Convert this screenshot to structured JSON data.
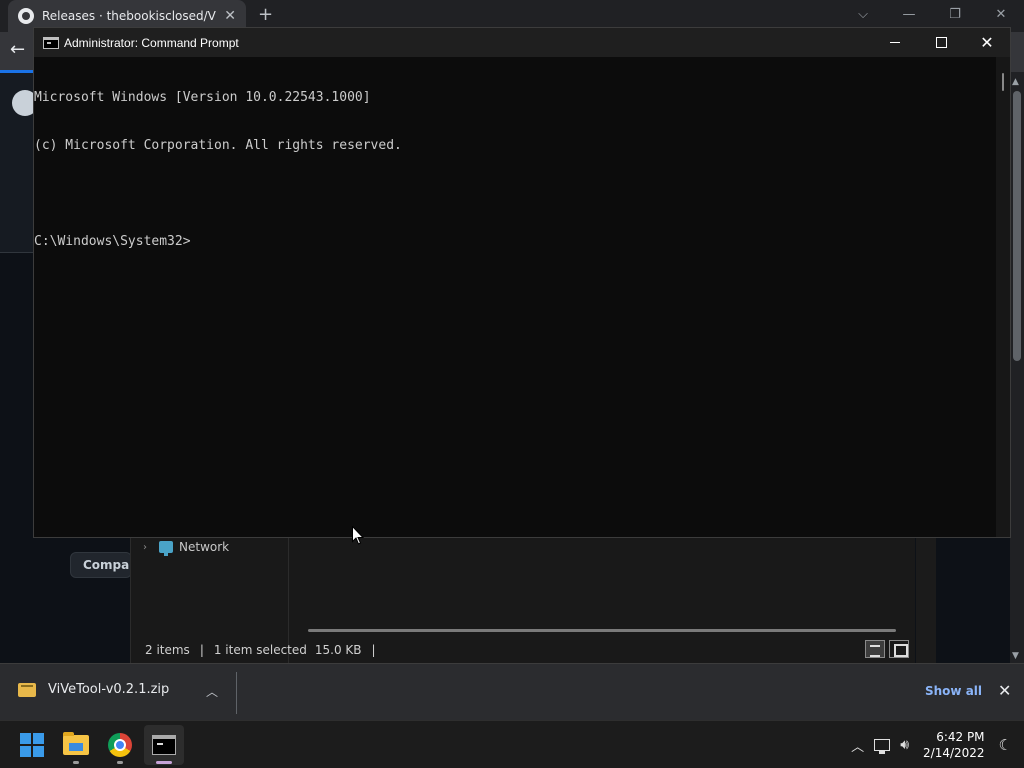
{
  "browser": {
    "tab_title": "Releases · thebookisclosed/ViVe",
    "new_tab": "+",
    "compare_button": "Compare"
  },
  "cmd": {
    "title": "Administrator: Command Prompt",
    "lines": [
      "Microsoft Windows [Version 10.0.22543.1000]",
      "(c) Microsoft Corporation. All rights reserved.",
      "",
      "C:\\Windows\\System32>"
    ]
  },
  "explorer": {
    "nav_item": "Network",
    "status_items": "2 items",
    "status_selected": "1 item selected",
    "status_size": "15.0 KB"
  },
  "downloads": {
    "file_name": "ViVeTool-v0.2.1.zip",
    "show_all": "Show all"
  },
  "taskbar": {
    "time": "6:42 PM",
    "date": "2/14/2022"
  },
  "colors": {
    "accent": "#3a9bea",
    "link": "#8ab4f8",
    "console_text": "#cccccc"
  },
  "icons": [
    "github-icon",
    "back-arrow-icon",
    "cmd-icon",
    "network-icon",
    "zip-file-icon",
    "windows-start-icon",
    "file-explorer-icon",
    "chrome-icon",
    "terminal-icon",
    "network-tray-icon",
    "volume-icon",
    "focus-assist-icon"
  ]
}
